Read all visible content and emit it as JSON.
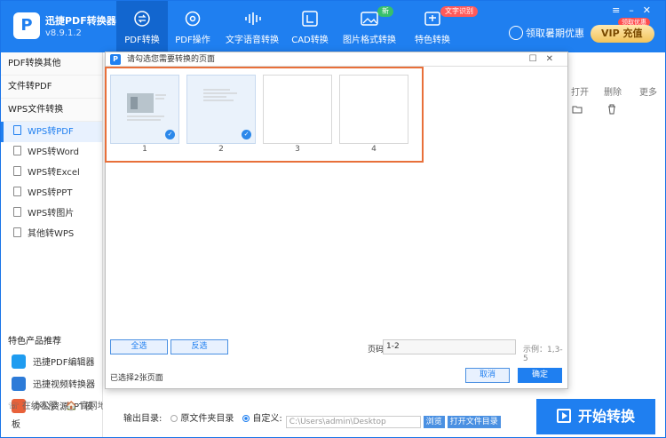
{
  "app": {
    "name": "迅捷PDF转换器",
    "version": "v8.9.1.2",
    "logo_glyph": "P"
  },
  "nav": [
    {
      "label": "PDF转换",
      "icon": "refresh-icon",
      "active": true
    },
    {
      "label": "PDF操作",
      "icon": "gear-icon"
    },
    {
      "label": "文字语音转换",
      "icon": "audio-wave-icon",
      "badge": "新"
    },
    {
      "label": "CAD转换",
      "icon": "cad-icon"
    },
    {
      "label": "图片格式转换",
      "icon": "image-icon"
    },
    {
      "label": "特色转换",
      "icon": "magic-icon",
      "badge": "文字识别"
    }
  ],
  "header": {
    "user_label": "领取暑期优惠",
    "vip_label": "VIP 充值",
    "vip_badge": "领取优惠"
  },
  "window_controls": {
    "menu": "≡",
    "minimize": "–",
    "close": "✕"
  },
  "sidebar": {
    "sections": [
      "PDF转换其他",
      "文件转PDF",
      "WPS文件转换"
    ],
    "items": [
      {
        "label": "WPS转PDF",
        "active": true
      },
      {
        "label": "WPS转Word"
      },
      {
        "label": "WPS转Excel"
      },
      {
        "label": "WPS转PPT"
      },
      {
        "label": "WPS转图片"
      },
      {
        "label": "其他转WPS"
      }
    ],
    "products_title": "特色产品推荐",
    "products": [
      "迅捷PDF编辑器",
      "迅捷视频转换器",
      "办公资源PPT模板"
    ],
    "footer": {
      "service": "在线客服",
      "website": "官网地址"
    }
  },
  "toolbar": {
    "open": "打开",
    "delete": "删除",
    "more": "更多"
  },
  "bottom": {
    "output_label": "输出目录:",
    "opt_source": "原文件夹目录",
    "opt_custom": "自定义:",
    "path": "C:\\Users\\admin\\Desktop",
    "browse": "浏览",
    "open_folder": "打开文件目录",
    "start": "开始转换"
  },
  "dialog": {
    "title": "请勾选您需要转换的页面",
    "pages": [
      {
        "num": "1",
        "selected": true
      },
      {
        "num": "2",
        "selected": true
      },
      {
        "num": "3",
        "selected": false
      },
      {
        "num": "4",
        "selected": false
      }
    ],
    "select_all": "全选",
    "invert": "反选",
    "page_label": "页码",
    "page_value": "1-2",
    "example": "示例：1,3-5",
    "status": "已选择2张页面",
    "cancel": "取消",
    "ok": "确定"
  },
  "colors": {
    "primary": "#1f7ff0",
    "highlight": "#e8703a"
  }
}
